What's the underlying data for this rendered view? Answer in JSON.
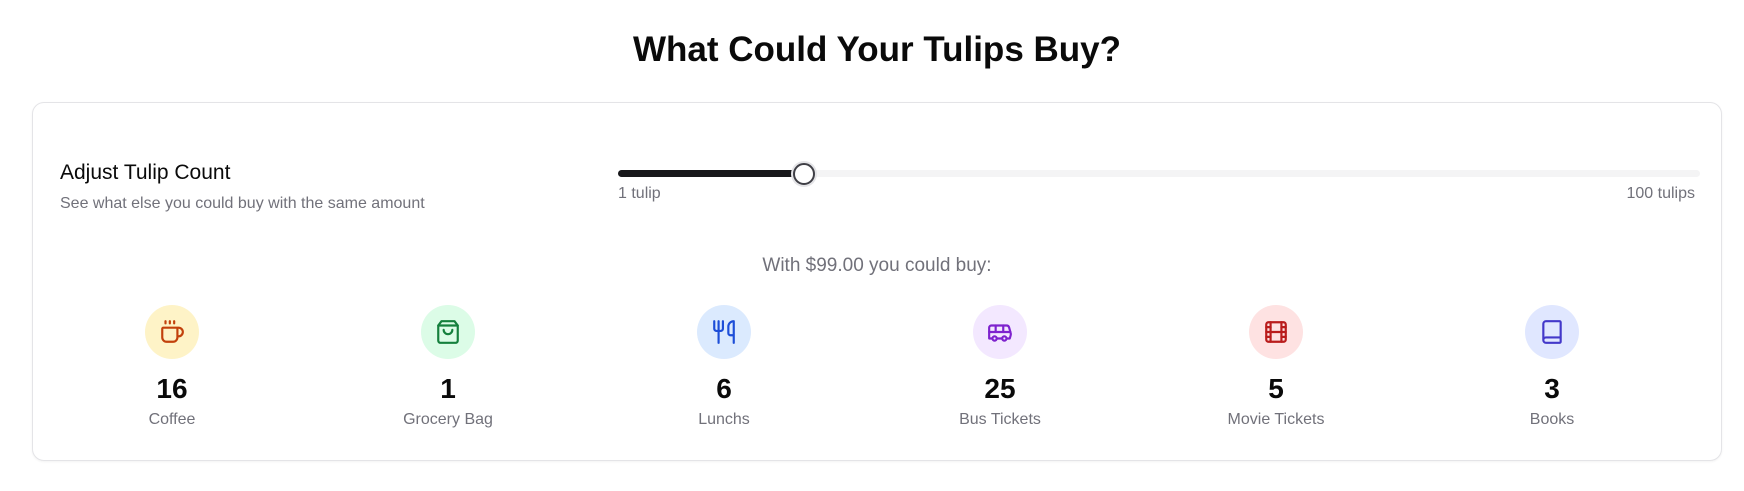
{
  "title": "What Could Your Tulips Buy?",
  "adjust": {
    "heading": "Adjust Tulip Count",
    "subtitle": "See what else you could buy with the same amount"
  },
  "slider": {
    "min_label": "1 tulip",
    "max_label": "100 tulips",
    "min": 1,
    "max": 100,
    "value": 18
  },
  "summary": "With $99.00 you could buy:",
  "items": [
    {
      "count": "16",
      "label": "Coffee",
      "icon": "coffee-cup-icon",
      "color": "#c2410c",
      "bg": "#fef3c7"
    },
    {
      "count": "1",
      "label": "Grocery Bag",
      "icon": "shopping-bag-icon",
      "color": "#15803d",
      "bg": "#dcfce7"
    },
    {
      "count": "6",
      "label": "Lunchs",
      "icon": "utensils-icon",
      "color": "#1d4ed8",
      "bg": "#dbeafe"
    },
    {
      "count": "25",
      "label": "Bus Tickets",
      "icon": "bus-icon",
      "color": "#7e22ce",
      "bg": "#f3e8ff"
    },
    {
      "count": "5",
      "label": "Movie Tickets",
      "icon": "film-icon",
      "color": "#b91c1c",
      "bg": "#fee2e2"
    },
    {
      "count": "3",
      "label": "Books",
      "icon": "book-icon",
      "color": "#4338ca",
      "bg": "#e0e7ff"
    }
  ]
}
